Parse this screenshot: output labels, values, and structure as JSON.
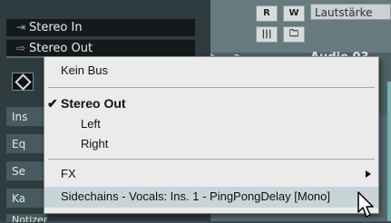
{
  "routing": {
    "input_label": "Stereo In",
    "output_label": "Stereo Out",
    "input_icon": "input-arrow-icon",
    "output_icon": "output-arrow-icon"
  },
  "sidebar": {
    "rows": [
      "Ins",
      "Eq",
      "Se",
      "Ka",
      "Notizen"
    ]
  },
  "track": {
    "volume_field": "Lautstärke",
    "number": "3",
    "name": "Audio 03",
    "buttons": [
      "R",
      "W"
    ]
  },
  "menu": {
    "no_bus": "Kein Bus",
    "selected_check": "✔",
    "selected": "Stereo Out",
    "left": "Left",
    "right": "Right",
    "fx": "FX",
    "sidechain": "Sidechains - Vocals: Ins. 1 - PingPongDelay [Mono]"
  },
  "colors": {
    "menu_bg": "#ebebeb",
    "highlight": "#c8d5d8",
    "panel_bg": "#2e3b3f",
    "accent_teal": "#6fb4b1"
  }
}
